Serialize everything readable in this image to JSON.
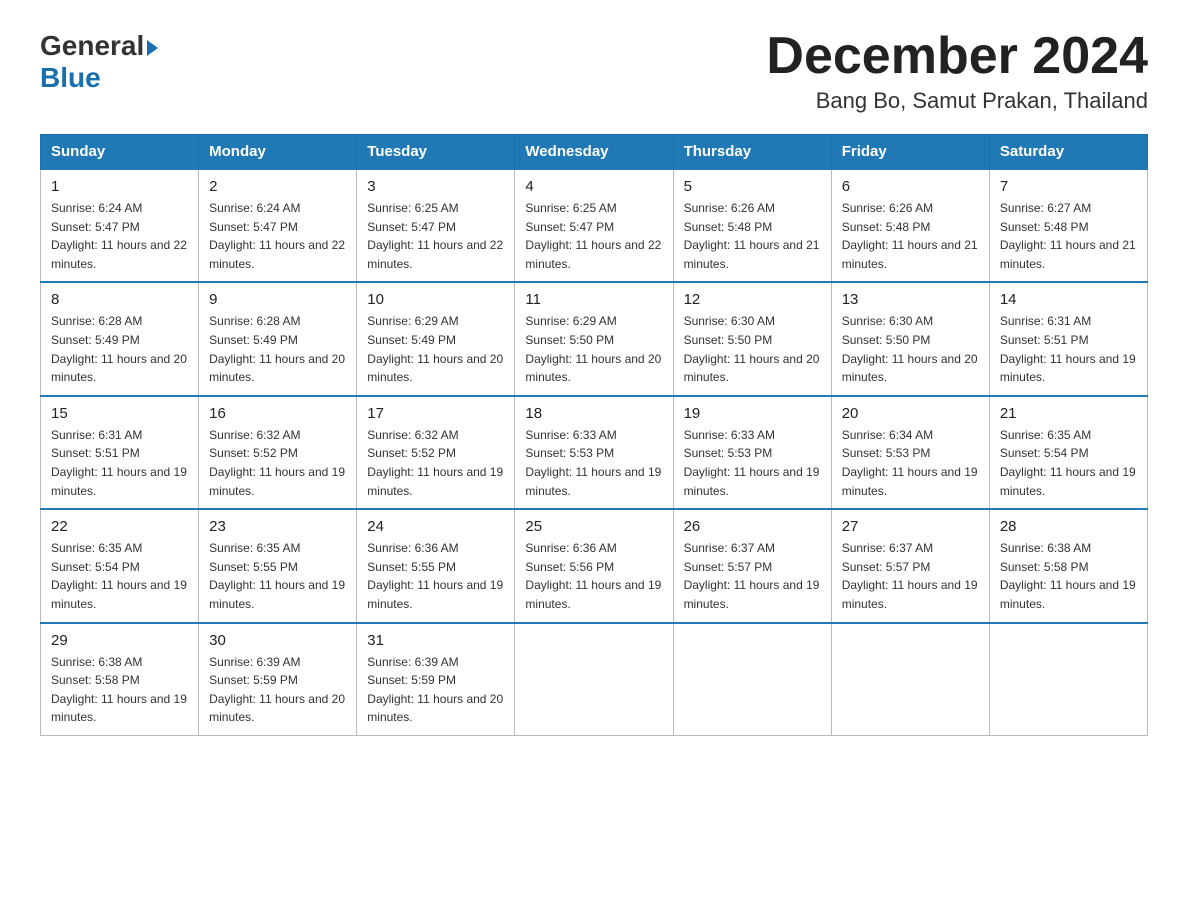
{
  "header": {
    "logo_line1": "General",
    "logo_line2": "Blue",
    "month_title": "December 2024",
    "subtitle": "Bang Bo, Samut Prakan, Thailand"
  },
  "days_of_week": [
    "Sunday",
    "Monday",
    "Tuesday",
    "Wednesday",
    "Thursday",
    "Friday",
    "Saturday"
  ],
  "weeks": [
    [
      {
        "date": "1",
        "sunrise": "6:24 AM",
        "sunset": "5:47 PM",
        "daylight": "11 hours and 22 minutes."
      },
      {
        "date": "2",
        "sunrise": "6:24 AM",
        "sunset": "5:47 PM",
        "daylight": "11 hours and 22 minutes."
      },
      {
        "date": "3",
        "sunrise": "6:25 AM",
        "sunset": "5:47 PM",
        "daylight": "11 hours and 22 minutes."
      },
      {
        "date": "4",
        "sunrise": "6:25 AM",
        "sunset": "5:47 PM",
        "daylight": "11 hours and 22 minutes."
      },
      {
        "date": "5",
        "sunrise": "6:26 AM",
        "sunset": "5:48 PM",
        "daylight": "11 hours and 21 minutes."
      },
      {
        "date": "6",
        "sunrise": "6:26 AM",
        "sunset": "5:48 PM",
        "daylight": "11 hours and 21 minutes."
      },
      {
        "date": "7",
        "sunrise": "6:27 AM",
        "sunset": "5:48 PM",
        "daylight": "11 hours and 21 minutes."
      }
    ],
    [
      {
        "date": "8",
        "sunrise": "6:28 AM",
        "sunset": "5:49 PM",
        "daylight": "11 hours and 20 minutes."
      },
      {
        "date": "9",
        "sunrise": "6:28 AM",
        "sunset": "5:49 PM",
        "daylight": "11 hours and 20 minutes."
      },
      {
        "date": "10",
        "sunrise": "6:29 AM",
        "sunset": "5:49 PM",
        "daylight": "11 hours and 20 minutes."
      },
      {
        "date": "11",
        "sunrise": "6:29 AM",
        "sunset": "5:50 PM",
        "daylight": "11 hours and 20 minutes."
      },
      {
        "date": "12",
        "sunrise": "6:30 AM",
        "sunset": "5:50 PM",
        "daylight": "11 hours and 20 minutes."
      },
      {
        "date": "13",
        "sunrise": "6:30 AM",
        "sunset": "5:50 PM",
        "daylight": "11 hours and 20 minutes."
      },
      {
        "date": "14",
        "sunrise": "6:31 AM",
        "sunset": "5:51 PM",
        "daylight": "11 hours and 19 minutes."
      }
    ],
    [
      {
        "date": "15",
        "sunrise": "6:31 AM",
        "sunset": "5:51 PM",
        "daylight": "11 hours and 19 minutes."
      },
      {
        "date": "16",
        "sunrise": "6:32 AM",
        "sunset": "5:52 PM",
        "daylight": "11 hours and 19 minutes."
      },
      {
        "date": "17",
        "sunrise": "6:32 AM",
        "sunset": "5:52 PM",
        "daylight": "11 hours and 19 minutes."
      },
      {
        "date": "18",
        "sunrise": "6:33 AM",
        "sunset": "5:53 PM",
        "daylight": "11 hours and 19 minutes."
      },
      {
        "date": "19",
        "sunrise": "6:33 AM",
        "sunset": "5:53 PM",
        "daylight": "11 hours and 19 minutes."
      },
      {
        "date": "20",
        "sunrise": "6:34 AM",
        "sunset": "5:53 PM",
        "daylight": "11 hours and 19 minutes."
      },
      {
        "date": "21",
        "sunrise": "6:35 AM",
        "sunset": "5:54 PM",
        "daylight": "11 hours and 19 minutes."
      }
    ],
    [
      {
        "date": "22",
        "sunrise": "6:35 AM",
        "sunset": "5:54 PM",
        "daylight": "11 hours and 19 minutes."
      },
      {
        "date": "23",
        "sunrise": "6:35 AM",
        "sunset": "5:55 PM",
        "daylight": "11 hours and 19 minutes."
      },
      {
        "date": "24",
        "sunrise": "6:36 AM",
        "sunset": "5:55 PM",
        "daylight": "11 hours and 19 minutes."
      },
      {
        "date": "25",
        "sunrise": "6:36 AM",
        "sunset": "5:56 PM",
        "daylight": "11 hours and 19 minutes."
      },
      {
        "date": "26",
        "sunrise": "6:37 AM",
        "sunset": "5:57 PM",
        "daylight": "11 hours and 19 minutes."
      },
      {
        "date": "27",
        "sunrise": "6:37 AM",
        "sunset": "5:57 PM",
        "daylight": "11 hours and 19 minutes."
      },
      {
        "date": "28",
        "sunrise": "6:38 AM",
        "sunset": "5:58 PM",
        "daylight": "11 hours and 19 minutes."
      }
    ],
    [
      {
        "date": "29",
        "sunrise": "6:38 AM",
        "sunset": "5:58 PM",
        "daylight": "11 hours and 19 minutes."
      },
      {
        "date": "30",
        "sunrise": "6:39 AM",
        "sunset": "5:59 PM",
        "daylight": "11 hours and 20 minutes."
      },
      {
        "date": "31",
        "sunrise": "6:39 AM",
        "sunset": "5:59 PM",
        "daylight": "11 hours and 20 minutes."
      },
      null,
      null,
      null,
      null
    ]
  ]
}
